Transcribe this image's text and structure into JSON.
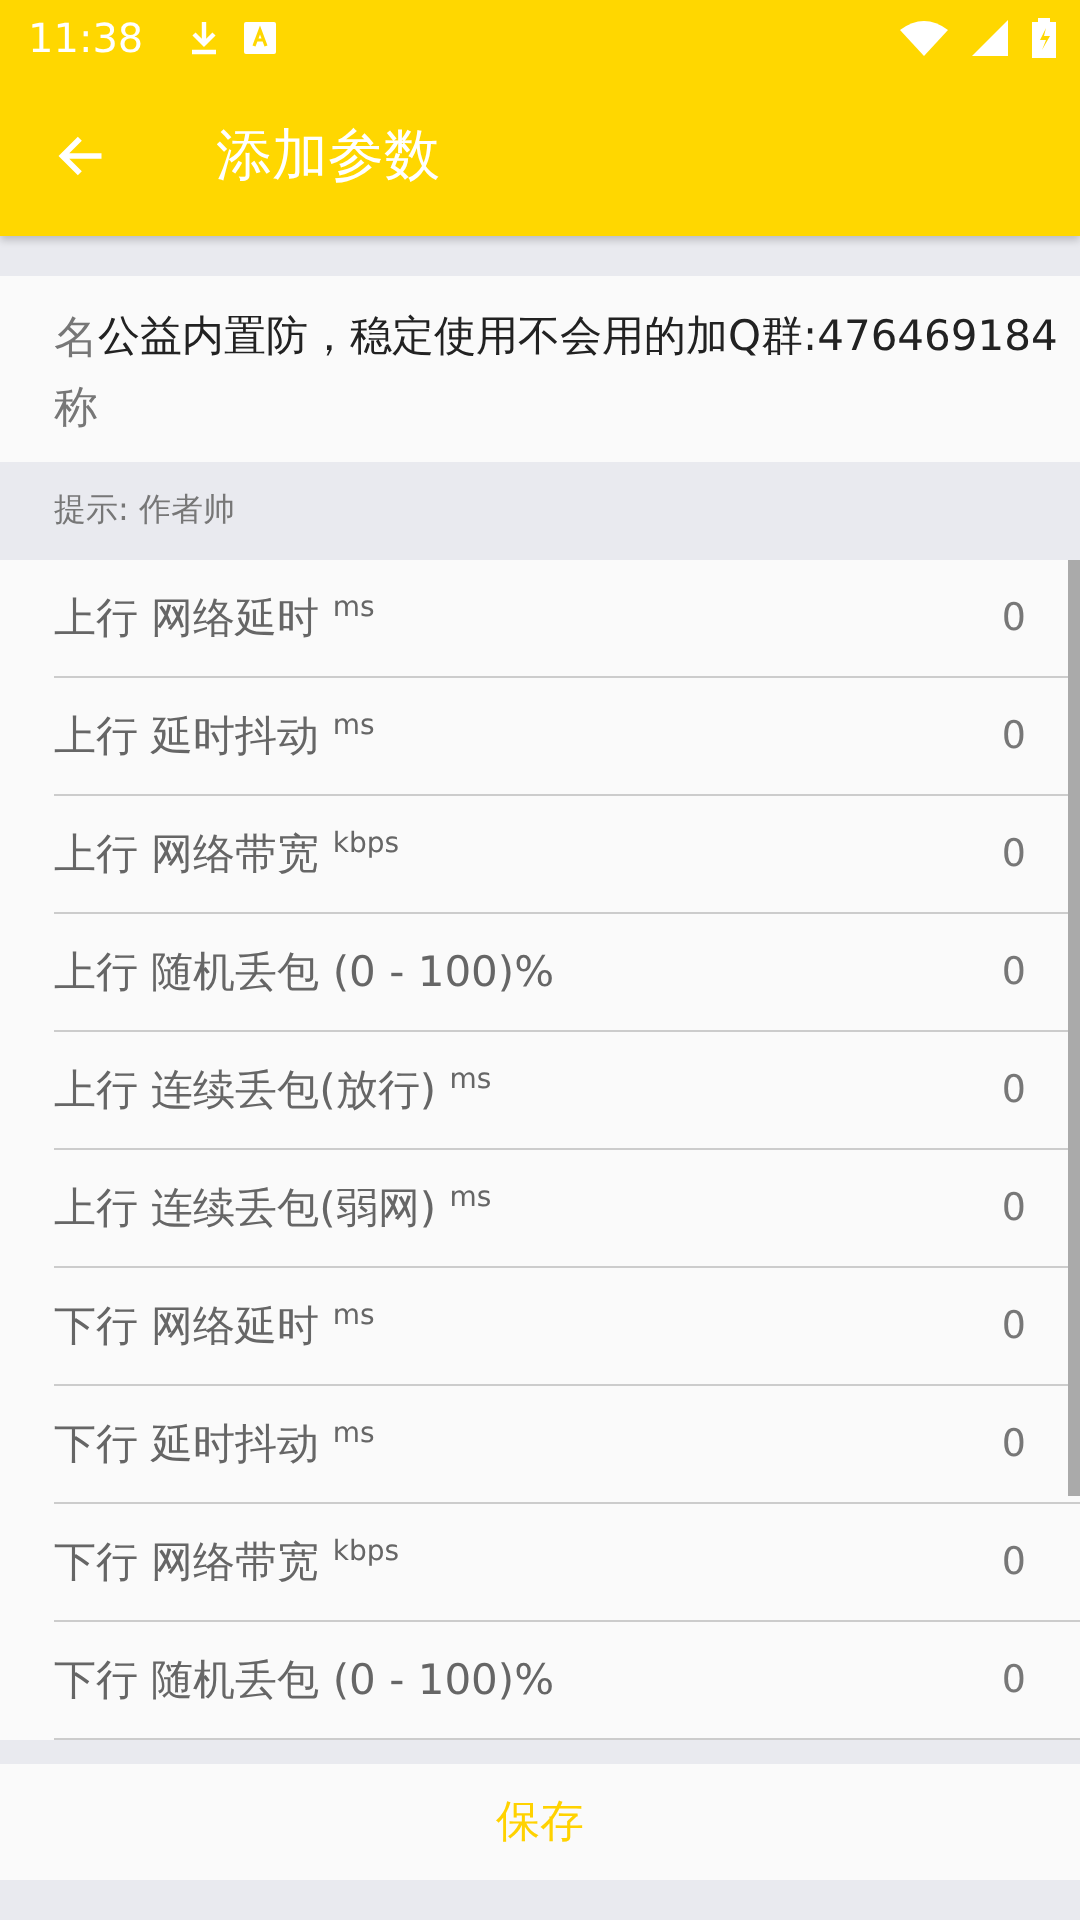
{
  "status_bar": {
    "time": "11:38"
  },
  "app_bar": {
    "title": "添加参数"
  },
  "name_field": {
    "label": "名称",
    "value": "公益内置防，稳定使用不会用的加Q群:476469184"
  },
  "hint": "提示: 作者帅",
  "params": [
    {
      "label": "上行 网络延时 $^{ms}$",
      "value": "0"
    },
    {
      "label": "上行 延时抖动 $^{ms}$",
      "value": "0"
    },
    {
      "label": "上行 网络带宽 $^{kbps}$",
      "value": "0"
    },
    {
      "label": "上行 随机丢包 (0 - 100)%",
      "value": "0"
    },
    {
      "label": "上行 连续丢包(放行) $^{ms}$",
      "value": "0"
    },
    {
      "label": "上行 连续丢包(弱网) $^{ms}$",
      "value": "0"
    },
    {
      "label": "下行 网络延时 $^{ms}$",
      "value": "0"
    },
    {
      "label": "下行 延时抖动 $^{ms}$",
      "value": "0"
    },
    {
      "label": "下行 网络带宽 $^{kbps}$",
      "value": "0"
    },
    {
      "label": "下行 随机丢包 (0 - 100)%",
      "value": "0"
    }
  ],
  "save_button": "保存"
}
